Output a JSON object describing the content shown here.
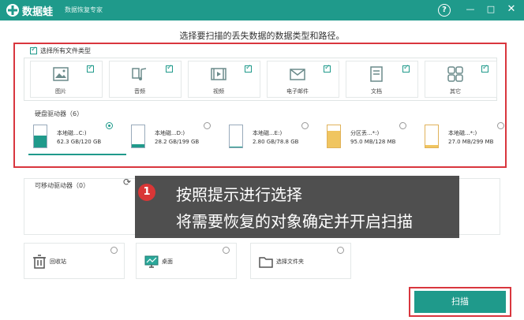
{
  "titlebar": {
    "app_name": "数据蛙",
    "subtitle": "数据恢复专家",
    "help": "?",
    "min": "—",
    "max": "□",
    "close": "✕",
    "bg_color": "#1f9a8b"
  },
  "instruction": "选择要扫描的丢失数据的数据类型和路径。",
  "select_all": {
    "label": "选择所有文件类型",
    "checked": true
  },
  "file_types": [
    {
      "label": "图片",
      "icon": "image-icon",
      "checked": true
    },
    {
      "label": "音频",
      "icon": "music-icon",
      "checked": true
    },
    {
      "label": "视频",
      "icon": "video-icon",
      "checked": true
    },
    {
      "label": "电子邮件",
      "icon": "email-icon",
      "checked": true
    },
    {
      "label": "文档",
      "icon": "document-icon",
      "checked": true
    },
    {
      "label": "其它",
      "icon": "other-icon",
      "checked": true
    }
  ],
  "hdd": {
    "label": "硬盘驱动器（6）",
    "drives": [
      {
        "name": "本地磁...C:)",
        "size": "62.3 GB/120 GB",
        "selected": true,
        "used": 0.52
      },
      {
        "name": "本地磁...D:)",
        "size": "28.2 GB/199 GB",
        "selected": false,
        "used": 0.14
      },
      {
        "name": "本地磁...E:)",
        "size": "2.80 GB/78.8 GB",
        "selected": false,
        "used": 0.04
      },
      {
        "name": "分区丢...*:)",
        "size": "95.0 MB/128 MB",
        "selected": false,
        "used": 0.74
      },
      {
        "name": "本地磁...*:)",
        "size": "27.0 MB/299 MB",
        "selected": false,
        "used": 0.09
      }
    ]
  },
  "removable": {
    "label": "可移动驱动器（0）"
  },
  "locations": [
    {
      "label": "回收站",
      "icon": "recycle-bin-icon"
    },
    {
      "label": "桌面",
      "icon": "desktop-icon"
    },
    {
      "label": "选择文件夹",
      "icon": "folder-icon"
    }
  ],
  "tooltip": {
    "number": "1",
    "line1": "按照提示进行选择",
    "line2": "将需要恢复的对象确定并开启扫描"
  },
  "scan_button": "扫描"
}
